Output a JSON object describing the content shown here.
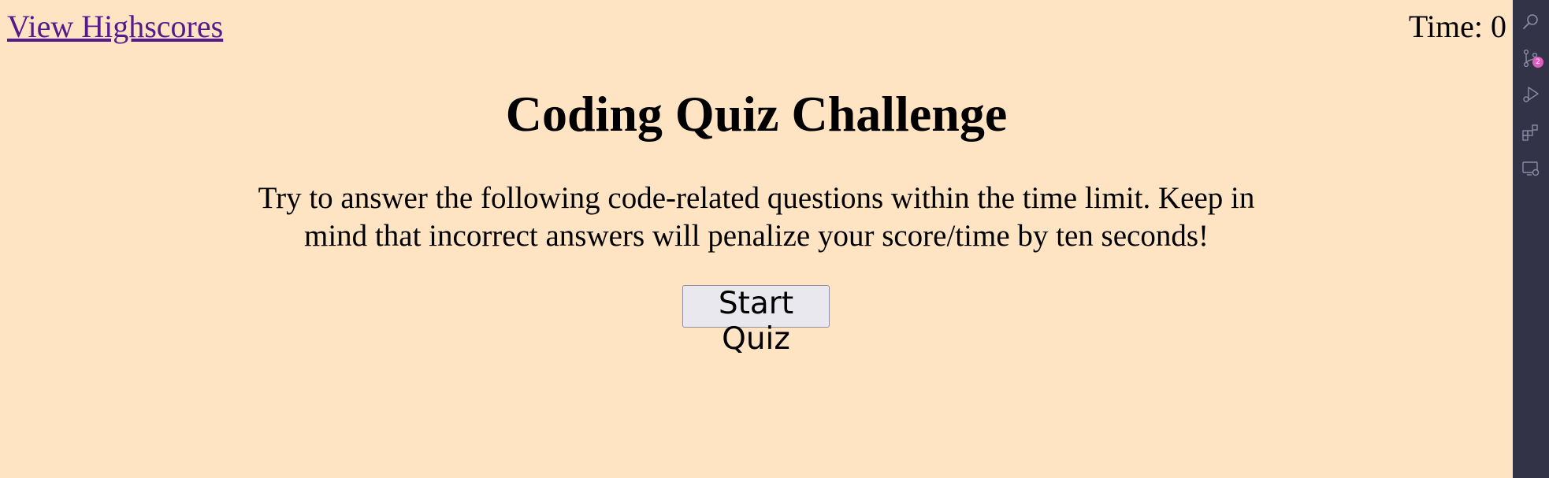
{
  "header": {
    "highscores_link": "View Highscores",
    "timer_label": "Time:",
    "timer_value": "0"
  },
  "main": {
    "title": "Coding Quiz Challenge",
    "intro": "Try to answer the following code-related questions within the time limit. Keep in mind that incorrect answers will penalize your score/time by ten seconds!",
    "start_button": "Start Quiz"
  },
  "activity_bar": {
    "items": [
      {
        "icon": "search-icon"
      },
      {
        "icon": "source-control-icon",
        "badge": "2"
      },
      {
        "icon": "run-debug-icon"
      },
      {
        "icon": "extensions-icon"
      },
      {
        "icon": "remote-explorer-icon"
      }
    ]
  },
  "colors": {
    "page_background": "#ffe4c4",
    "link": "#551a8b",
    "activity_bar_background": "#323346",
    "badge": "#e05cc0"
  }
}
